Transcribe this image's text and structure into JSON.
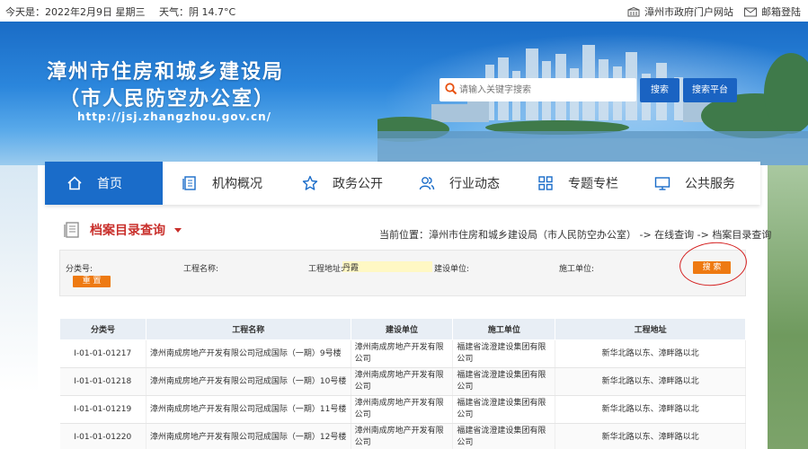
{
  "topbar": {
    "date_text": "今天是：2022年2月9日 星期三",
    "weather_text": "天气：阴 14.7°C",
    "portal_link": "漳州市政府门户网站",
    "mail_link": "邮箱登陆"
  },
  "header": {
    "title_line1": "漳州市住房和城乡建设局",
    "title_line2": "（市人民防空办公室）",
    "url": "http://jsj.zhangzhou.gov.cn/",
    "search_placeholder": "请输入关键字搜索",
    "search_button": "搜索",
    "platform_button": "搜索平台"
  },
  "nav": {
    "items": [
      {
        "label": "首页",
        "icon": "home-icon"
      },
      {
        "label": "机构概况",
        "icon": "document-icon"
      },
      {
        "label": "政务公开",
        "icon": "star-icon"
      },
      {
        "label": "行业动态",
        "icon": "people-icon"
      },
      {
        "label": "专题专栏",
        "icon": "grid-icon"
      },
      {
        "label": "公共服务",
        "icon": "monitor-icon"
      }
    ]
  },
  "section": {
    "title": "档案目录查询",
    "breadcrumb": "当前位置：漳州市住房和城乡建设局（市人民防空办公室） -> 在线查询 -> 档案目录查询"
  },
  "filter": {
    "category_label": "分类号:",
    "project_name_label": "工程名称:",
    "project_address_label": "工程地址:",
    "project_address_value": "丹霞",
    "builder_label": "建设单位:",
    "contractor_label": "施工单位:",
    "search_button": "搜 索",
    "reset_button": "重 置"
  },
  "table": {
    "headers": [
      "分类号",
      "工程名称",
      "建设单位",
      "施工单位",
      "工程地址"
    ],
    "rows": [
      [
        "I-01-01-01217",
        "漳州南成房地产开发有限公司冠成国际（一期）9号楼",
        "漳州南成房地产开发有限公司",
        "福建省泷澄建设集团有限公司",
        "新华北路以东、漳畔路以北"
      ],
      [
        "I-01-01-01218",
        "漳州南成房地产开发有限公司冠成国际（一期）10号楼",
        "漳州南成房地产开发有限公司",
        "福建省泷澄建设集团有限公司",
        "新华北路以东、漳畔路以北"
      ],
      [
        "I-01-01-01219",
        "漳州南成房地产开发有限公司冠成国际（一期）11号楼",
        "漳州南成房地产开发有限公司",
        "福建省泷澄建设集团有限公司",
        "新华北路以东、漳畔路以北"
      ],
      [
        "I-01-01-01220",
        "漳州南成房地产开发有限公司冠成国际（一期）12号楼",
        "漳州南成房地产开发有限公司",
        "福建省泷澄建设集团有限公司",
        "新华北路以东、漳畔路以北"
      ]
    ]
  },
  "colors": {
    "primary_blue": "#1a6cc9",
    "accent_orange": "#ee7a12",
    "title_red": "#c9302c"
  }
}
